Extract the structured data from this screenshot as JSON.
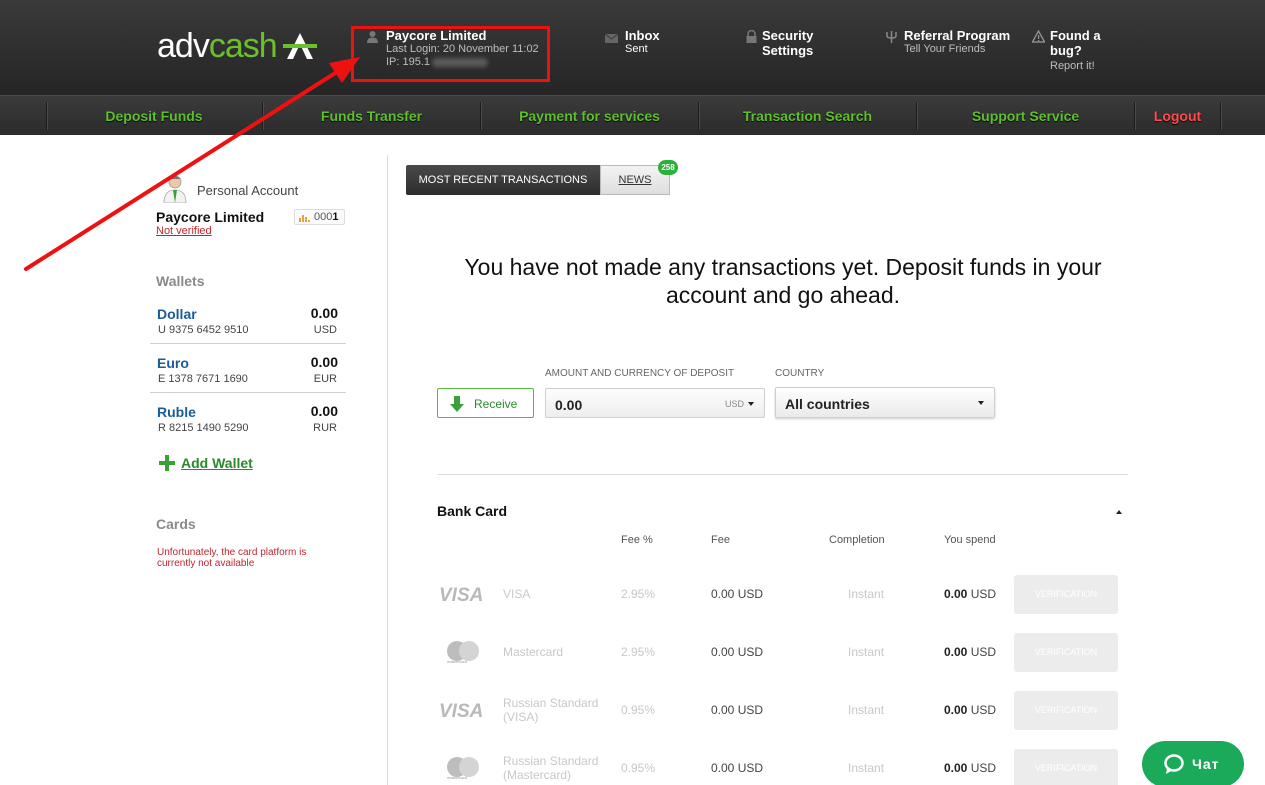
{
  "header": {
    "logo": {
      "part1": "adv",
      "part2": "cash"
    },
    "user": {
      "name": "Paycore Limited",
      "last_login": "Last Login: 20 November 11:02",
      "ip_prefix": "IP: 195.1"
    },
    "inbox": {
      "title": "Inbox",
      "sub": "Sent"
    },
    "security": {
      "line1": "Security",
      "line2": "Settings"
    },
    "referral": {
      "title": "Referral Program",
      "sub": "Tell Your Friends"
    },
    "bug": {
      "line1": "Found a",
      "line2": "bug?",
      "sub": "Report it!"
    }
  },
  "nav": {
    "items": [
      "Deposit Funds",
      "Funds Transfer",
      "Payment for services",
      "Transaction Search",
      "Support Service",
      "Logout"
    ]
  },
  "sidebar": {
    "account_type": "Personal Account",
    "account_name": "Paycore Limited",
    "verification": "Not verified",
    "level_prefix": "000",
    "level_value": "1",
    "wallets_heading": "Wallets",
    "wallets": [
      {
        "name": "Dollar",
        "number": "U 9375 6452 9510",
        "balance": "0.00",
        "currency": "USD"
      },
      {
        "name": "Euro",
        "number": "E 1378 7671 1690",
        "balance": "0.00",
        "currency": "EUR"
      },
      {
        "name": "Ruble",
        "number": "R 8215 1490 5290",
        "balance": "0.00",
        "currency": "RUR"
      }
    ],
    "add_wallet": "Add Wallet",
    "cards_heading": "Cards",
    "cards_note": "Unfortunately, the card platform is currently not available"
  },
  "main": {
    "tabs": {
      "recent": "MOST RECENT TRANSACTIONS",
      "news": "NEWS",
      "news_count": "258"
    },
    "empty_message": "You have not made any transactions yet. Deposit funds in your account and go ahead.",
    "receive_label": "Receive",
    "amount_label": "AMOUNT AND CURRENCY OF DEPOSIT",
    "amount_value": "0.00",
    "amount_currency": "USD",
    "country_label": "COUNTRY",
    "country_value": "All countries",
    "bank_card_heading": "Bank Card",
    "columns": {
      "fee_pct": "Fee %",
      "fee": "Fee",
      "completion": "Completion",
      "spend": "You spend"
    },
    "methods": [
      {
        "logo": "visa-logo",
        "name": "VISA",
        "fee_pct": "2.95%",
        "fee": "0.00 USD",
        "completion": "Instant",
        "spend_amount": "0.00",
        "spend_currency": "USD",
        "button": "VERIFICATION"
      },
      {
        "logo": "mastercard-logo",
        "name": "Mastercard",
        "fee_pct": "2.95%",
        "fee": "0.00 USD",
        "completion": "Instant",
        "spend_amount": "0.00",
        "spend_currency": "USD",
        "button": "VERIFICATION"
      },
      {
        "logo": "visa-logo",
        "name": "Russian Standard (VISA)",
        "fee_pct": "0.95%",
        "fee": "0.00 USD",
        "completion": "Instant",
        "spend_amount": "0.00",
        "spend_currency": "USD",
        "button": "VERIFICATION"
      },
      {
        "logo": "mastercard-logo",
        "name": "Russian Standard (Mastercard)",
        "fee_pct": "0.95%",
        "fee": "0.00 USD",
        "completion": "Instant",
        "spend_amount": "0.00",
        "spend_currency": "USD",
        "button": "VERIFICATION"
      }
    ]
  },
  "chat": {
    "label": "Чат"
  },
  "colors": {
    "brand_green": "#6ac12c",
    "nav_green": "#5cc02b",
    "logout_red": "#ff4b4b",
    "annotation_red": "#ee1111",
    "wallet_blue": "#1a5c99"
  }
}
